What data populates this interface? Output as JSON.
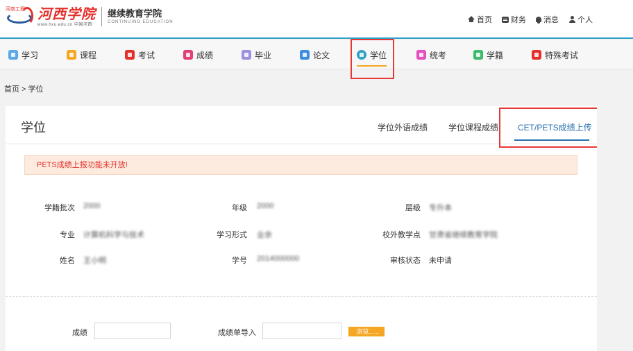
{
  "header": {
    "logo_seal": "河南工程",
    "brand": "河西学院",
    "brand_url": "www.hxu.edu.cn 中国河西",
    "college": "继续教育学院",
    "college_en": "CONTINUING EDUCATION",
    "links": [
      {
        "label": "首页",
        "icon": "home-icon"
      },
      {
        "label": "财务",
        "icon": "wallet-icon"
      },
      {
        "label": "消息",
        "icon": "bell-icon"
      },
      {
        "label": "个人",
        "icon": "user-icon"
      }
    ]
  },
  "nav": {
    "items": [
      {
        "label": "学习",
        "color": "#5aa9e6"
      },
      {
        "label": "课程",
        "color": "#f5a623"
      },
      {
        "label": "考试",
        "color": "#e4302b"
      },
      {
        "label": "成绩",
        "color": "#e23e78"
      },
      {
        "label": "毕业",
        "color": "#9b8fe0"
      },
      {
        "label": "论文",
        "color": "#3b8de0"
      },
      {
        "label": "学位",
        "color": "#2fa1c4"
      },
      {
        "label": "统考",
        "color": "#e64fc0"
      },
      {
        "label": "学籍",
        "color": "#3dbb6d"
      },
      {
        "label": "特殊考试",
        "color": "#e4302b"
      }
    ],
    "active": "学位"
  },
  "breadcrumb": "首页 > 学位",
  "page": {
    "title": "学位",
    "tabs": [
      "学位外语成绩",
      "学位课程成绩",
      "CET/PETS成绩上传"
    ],
    "active_tab": "CET/PETS成绩上传",
    "alert": "PETS成绩上报功能未开放!"
  },
  "info": {
    "batch_label": "学籍批次",
    "batch_value": "2000",
    "grade_label": "年级",
    "grade_value": "2000",
    "level_label": "层级",
    "level_value": "专升本",
    "major_label": "专业",
    "major_value": "计算机科学与技术",
    "mode_label": "学习形式",
    "mode_value": "业余",
    "center_label": "校外教学点",
    "center_value": "甘肃省继续教育学院",
    "name_label": "姓名",
    "name_value": "王小明",
    "id_label": "学号",
    "id_value": "2014000000",
    "status_label": "审核状态",
    "status_value": "未申请"
  },
  "form": {
    "score_label": "成绩",
    "import_label": "成绩单导入",
    "browse_label": "浏览......"
  }
}
